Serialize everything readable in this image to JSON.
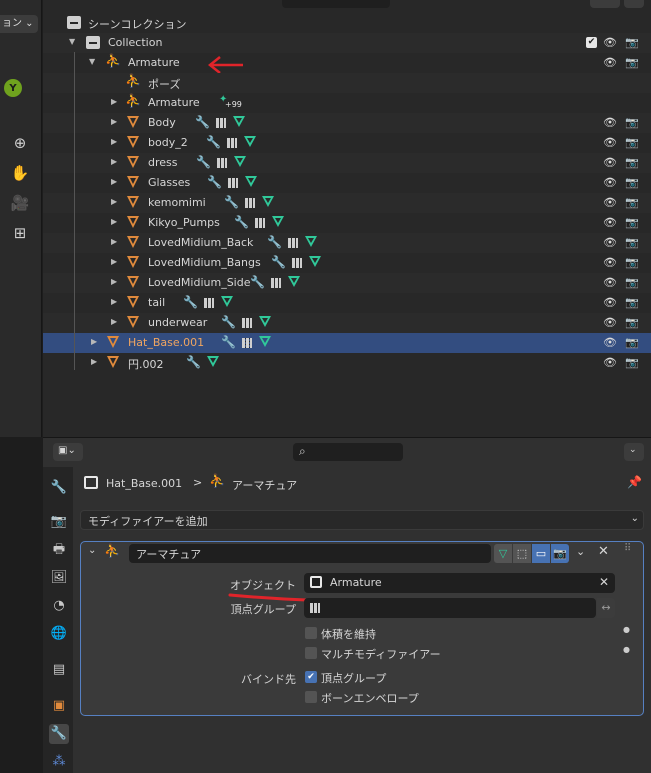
{
  "left_strip": {
    "dropdown_label": "ョン",
    "gizmo_axis": "Y",
    "tools": [
      "zoom-icon",
      "hand-icon",
      "camera-icon",
      "grid-icon"
    ]
  },
  "outliner": {
    "scene_collection": "シーンコレクション",
    "collection": "Collection",
    "rows": [
      {
        "name": "Armature",
        "kind": "armature"
      },
      {
        "name": "ポーズ",
        "kind": "pose"
      },
      {
        "name": "Armature",
        "kind": "armature-data",
        "badge": "99"
      },
      {
        "name": "Body"
      },
      {
        "name": "body_2"
      },
      {
        "name": "dress"
      },
      {
        "name": "Glasses"
      },
      {
        "name": "kemomimi"
      },
      {
        "name": "Kikyo_Pumps"
      },
      {
        "name": "LovedMidium_Back"
      },
      {
        "name": "LovedMidium_Bangs"
      },
      {
        "name": "LovedMidium_Side"
      },
      {
        "name": "tail"
      },
      {
        "name": "underwear"
      },
      {
        "name": "Hat_Base.001",
        "selected": true
      },
      {
        "name": "円.002"
      }
    ]
  },
  "properties": {
    "breadcrumb_object": "Hat_Base.001",
    "breadcrumb_sep": ">",
    "breadcrumb_modifier": "アーマチュア",
    "add_modifier": "モディファイアーを追加",
    "modifier_name": "アーマチュア",
    "object_label": "オブジェクト",
    "object_value": "Armature",
    "vertex_group_label": "頂点グループ",
    "preserve_volume": "体積を維持",
    "multi_modifier": "マルチモディファイアー",
    "bind_to_label": "バインド先",
    "bind_vertex_groups": "頂点グループ",
    "bind_bone_envelopes": "ボーンエンベロープ"
  },
  "annotations": {
    "arrow_color": "#e0242a",
    "underline_color": "#e0242a"
  }
}
